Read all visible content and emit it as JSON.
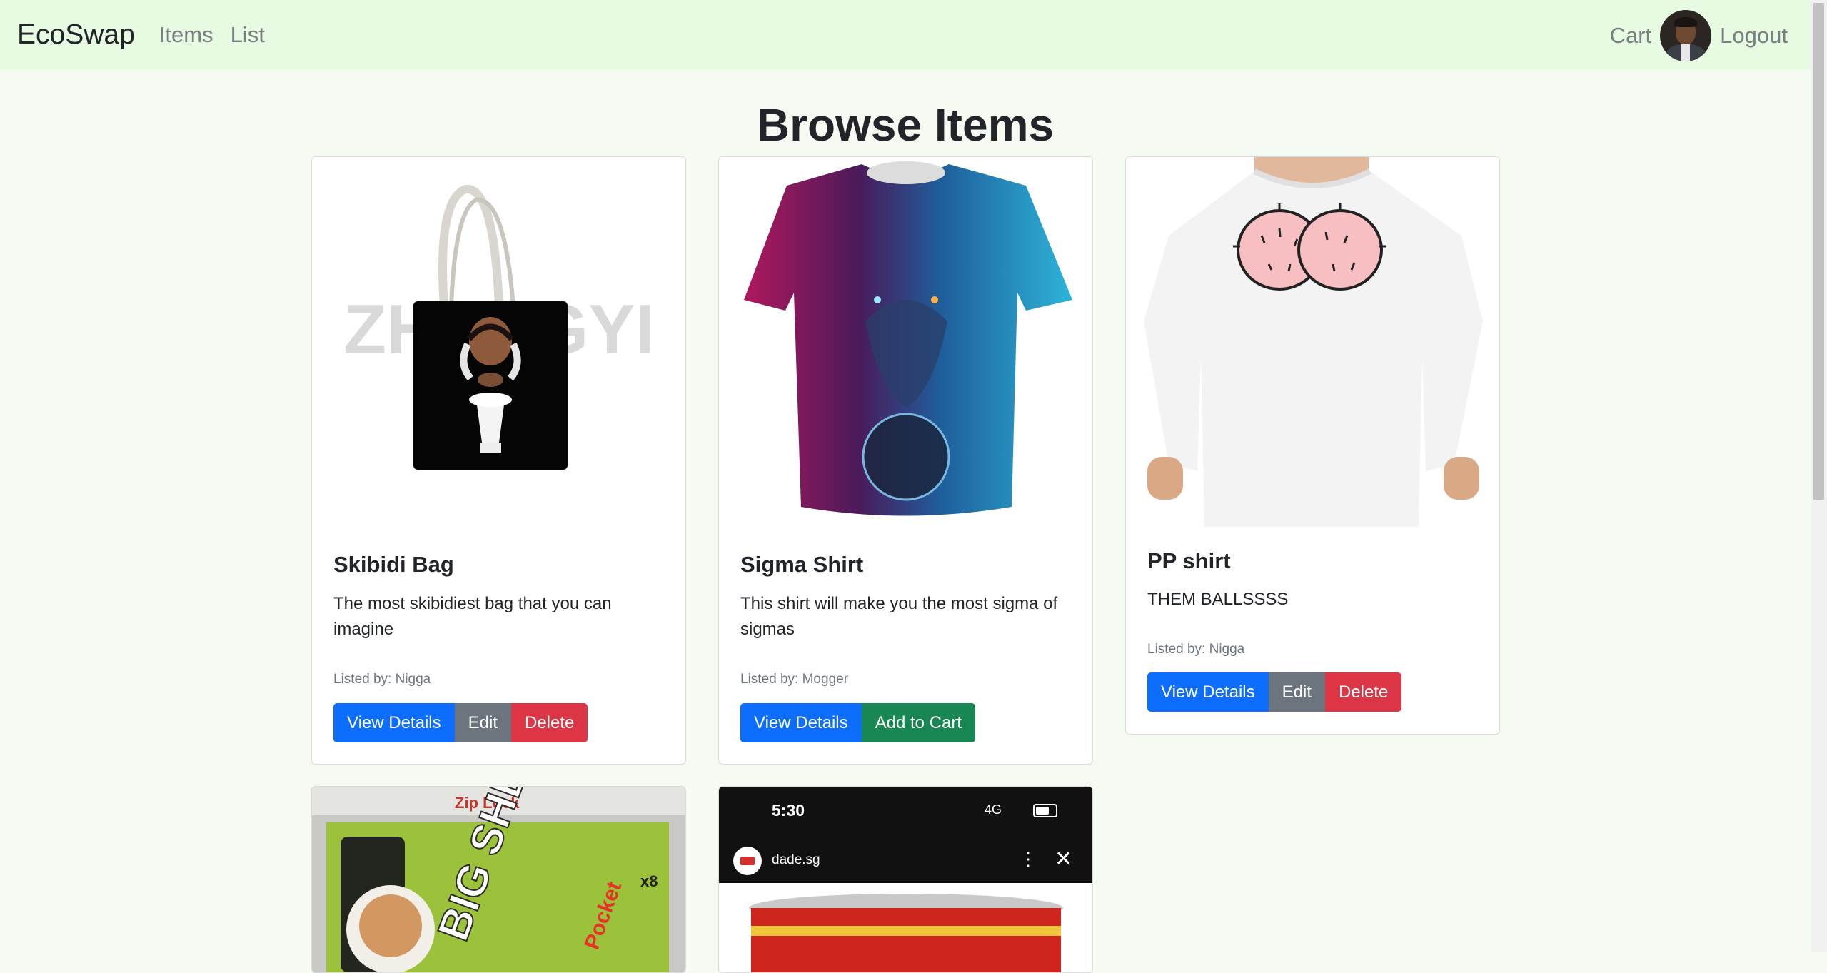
{
  "nav": {
    "brand": "EcoSwap",
    "links": [
      "Items",
      "List"
    ],
    "cart": "Cart",
    "logout": "Logout"
  },
  "page": {
    "title": "Browse Items"
  },
  "items": [
    {
      "title": "Skibidi Bag",
      "description": "The most skibidiest bag that you can imagine",
      "listed_by": "Listed by: Nigga",
      "buttons": [
        "View Details",
        "Edit",
        "Delete"
      ],
      "watermark": "ZHENGYI"
    },
    {
      "title": "Sigma Shirt",
      "description": "This shirt will make you the most sigma of sigmas",
      "listed_by": "Listed by: Mogger",
      "buttons": [
        "View Details",
        "Add to Cart"
      ]
    },
    {
      "title": "PP shirt",
      "description": "THEM BALLSSSS",
      "listed_by": "Listed by: Nigga",
      "buttons": [
        "View Details",
        "Edit",
        "Delete"
      ]
    },
    {
      "image_text": [
        "Zip Lock",
        "BIG SHEET",
        "Pocket",
        "x8"
      ]
    },
    {
      "phone": {
        "time": "5:30",
        "network": "4G",
        "url": "dade.sg"
      }
    }
  ],
  "colors": {
    "navbar_bg": "#e6fbe1",
    "page_bg": "#f5fbf3",
    "primary": "#0d6efd",
    "secondary": "#6c757d",
    "danger": "#dc3545",
    "success": "#198754"
  },
  "icons": {
    "menu": "kebab-menu-icon",
    "close": "close-icon",
    "battery": "battery-icon",
    "signal": "signal-icon"
  }
}
